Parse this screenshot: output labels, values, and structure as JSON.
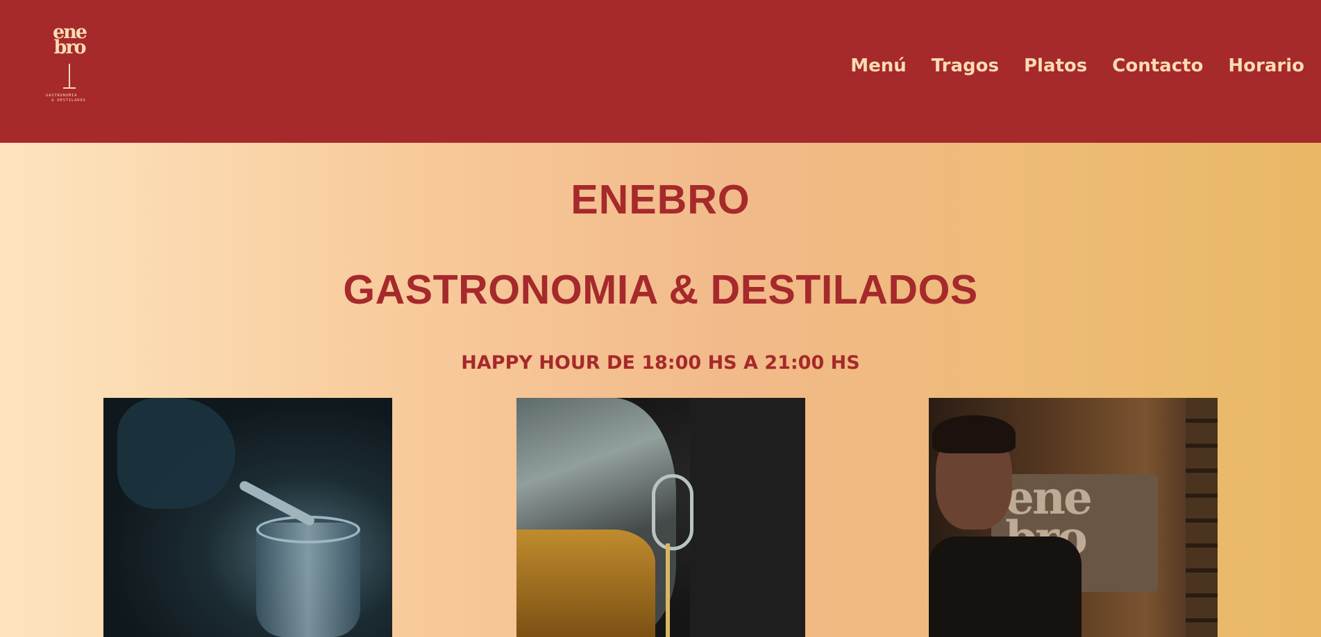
{
  "header": {
    "logo": {
      "word_line1": "ene",
      "word_line2": "bro",
      "tagline": "GASTRONOMIA\n  & DESTILADOS"
    },
    "nav": [
      {
        "label": "Menú"
      },
      {
        "label": "Tragos"
      },
      {
        "label": "Platos"
      },
      {
        "label": "Contacto"
      },
      {
        "label": "Horario"
      }
    ]
  },
  "hero": {
    "title": "ENEBRO",
    "subtitle": "GASTRONOMIA & DESTILADOS",
    "happy_hour": "HAPPY HOUR DE 18:00 HS A 21:00 HS",
    "photo3_sign": "ene\nbro"
  },
  "colors": {
    "brand_red": "#a6292b",
    "cream": "#f8dcb3",
    "gradient_start": "#fde4bf",
    "gradient_end": "#e8b865"
  },
  "icons": [
    "logo-wine-glass"
  ]
}
